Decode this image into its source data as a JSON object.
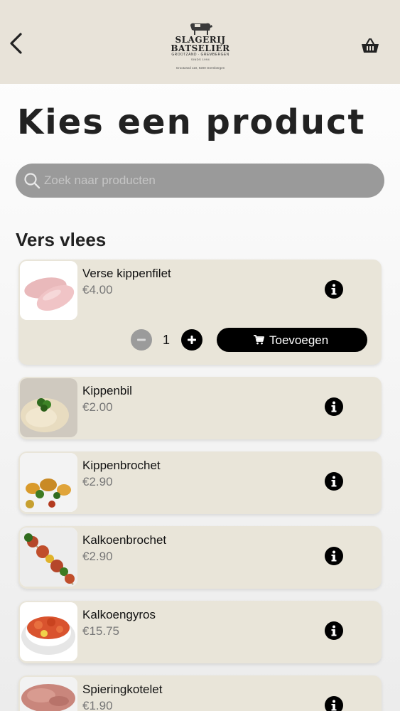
{
  "header": {
    "logo": {
      "name_line1": "SLAGERIJ",
      "name_line2": "BATSELIER",
      "sub": "GROOTZAND · GREMBERGEN",
      "since": "SINDS 1994",
      "address": "Grootzand 110, 9200 Grembergen"
    }
  },
  "page_title": "Kies een product",
  "search": {
    "placeholder": "Zoek naar producten",
    "value": ""
  },
  "section_title": "Vers vlees",
  "products": [
    {
      "name": "Verse kippenfilet",
      "price": "€4.00",
      "quantity": "1",
      "add_label": "Toevoegen"
    },
    {
      "name": "Kippenbil",
      "price": "€2.00"
    },
    {
      "name": "Kippenbrochet",
      "price": "€2.90"
    },
    {
      "name": "Kalkoenbrochet",
      "price": "€2.90"
    },
    {
      "name": "Kalkoengyros",
      "price": "€15.75"
    },
    {
      "name": "Spieringkotelet",
      "price": "€1.90"
    }
  ],
  "icons": {
    "back": "chevron-left-icon",
    "cart": "basket-icon",
    "search": "search-icon",
    "info": "info-icon",
    "minus": "minus-icon",
    "plus": "plus-icon",
    "add": "cart-icon"
  },
  "colors": {
    "header_bg": "#e8e3d9",
    "card_bg": "#e9e5d9",
    "search_bg": "#9a9a9a",
    "primary": "#000000",
    "minus_bg": "#9b9b9b"
  }
}
